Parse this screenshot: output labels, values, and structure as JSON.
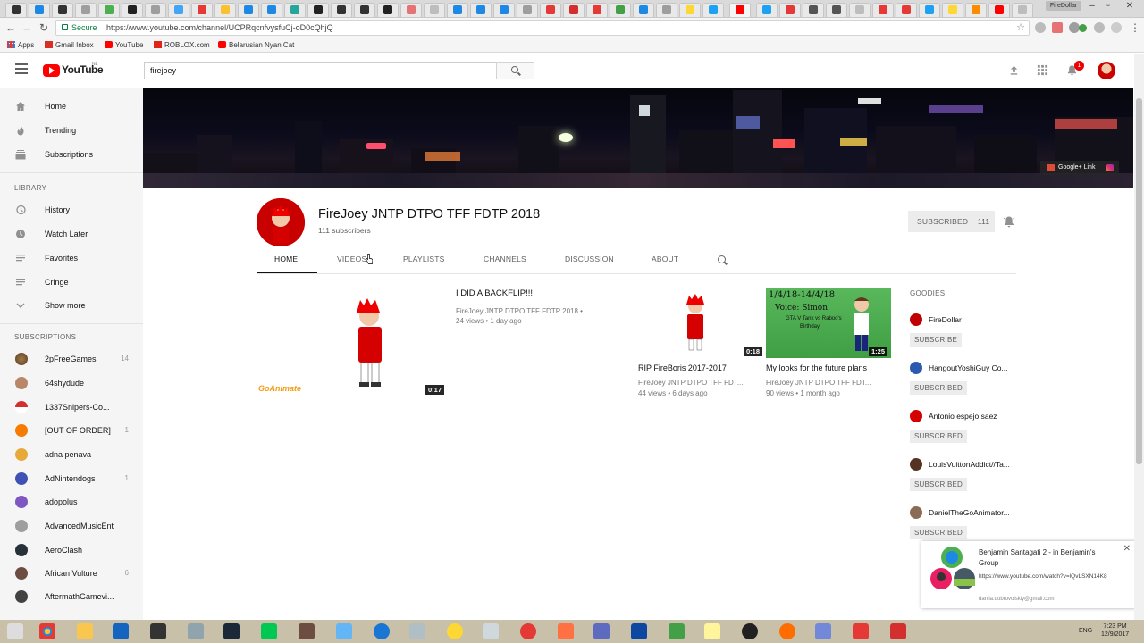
{
  "browser": {
    "profile_name": "FireDollar",
    "secure_label": "Secure",
    "url": "https://www.youtube.com/channel/UCPRqcnfvysfuCj-oD0cQhjQ",
    "bookmarks": [
      {
        "label": "Apps"
      },
      {
        "label": "Gmail Inbox"
      },
      {
        "label": "YouTube"
      },
      {
        "label": "ROBLOX.com"
      },
      {
        "label": "Belarusian Nyan Cat"
      }
    ]
  },
  "youtube": {
    "logo_text": "YouTube",
    "region": "NL",
    "search_value": "firejoey",
    "notification_count": "1"
  },
  "sidebar": {
    "main": [
      {
        "label": "Home",
        "icon": "home-icon"
      },
      {
        "label": "Trending",
        "icon": "flame-icon"
      },
      {
        "label": "Subscriptions",
        "icon": "subscriptions-icon"
      }
    ],
    "library_heading": "LIBRARY",
    "library": [
      {
        "label": "History",
        "icon": "history-icon"
      },
      {
        "label": "Watch Later",
        "icon": "clock-icon"
      },
      {
        "label": "Favorites",
        "icon": "playlist-icon"
      },
      {
        "label": "Cringe",
        "icon": "playlist-icon"
      },
      {
        "label": "Show more",
        "icon": "chevron-down-icon"
      }
    ],
    "subscriptions_heading": "SUBSCRIPTIONS",
    "subscriptions": [
      {
        "label": "2pFreeGames",
        "count": "14"
      },
      {
        "label": "64shydude",
        "count": ""
      },
      {
        "label": "1337Snipers-Co...",
        "count": ""
      },
      {
        "label": "[OUT OF ORDER]",
        "count": "1"
      },
      {
        "label": "adna penava",
        "count": ""
      },
      {
        "label": "AdNintendogs",
        "count": "1"
      },
      {
        "label": "adopolus",
        "count": ""
      },
      {
        "label": "AdvancedMusicEnt",
        "count": ""
      },
      {
        "label": "AeroClash",
        "count": ""
      },
      {
        "label": "African Vulture",
        "count": "6"
      },
      {
        "label": "AftermathGamevi...",
        "count": ""
      }
    ]
  },
  "banner": {
    "gplus_label": "Google+ Link"
  },
  "channel": {
    "title": "FireJoey JNTP DTPO TFF FDTP 2018",
    "subscribers": "111 subscribers",
    "subscribe_label": "SUBSCRIBED",
    "subscribe_count": "111",
    "tabs": [
      "HOME",
      "VIDEOS",
      "PLAYLISTS",
      "CHANNELS",
      "DISCUSSION",
      "ABOUT"
    ]
  },
  "featured": {
    "title": "I DID A BACKFLIP!!!",
    "channel": "FireJoey JNTP DTPO TFF FDTP 2018 •",
    "meta": "24 views • 1 day ago",
    "duration": "0:17",
    "watermark": "GoAnimate"
  },
  "videos": [
    {
      "title": "RIP FireBoris 2017-2017",
      "channel": "FireJoey JNTP DTPO TFF FDT...",
      "meta": "44 views • 6 days ago",
      "duration": "0:18"
    },
    {
      "title": "My looks for the future plans",
      "channel": "FireJoey JNTP DTPO TFF FDT...",
      "meta": "90 views • 1 month ago",
      "duration": "1:25",
      "thumb_text_1": "1/4/18-14/4/18",
      "thumb_text_2": "Voice: Simon",
      "thumb_text_3": "GTA V Tank vs Raboo's",
      "thumb_text_4": "Birthday"
    }
  ],
  "goodies": {
    "heading": "GOODIES",
    "items": [
      {
        "name": "FireDollar",
        "button": "SUBSCRIBE",
        "color": "#c00000"
      },
      {
        "name": "HangoutYoshiGuy Co...",
        "button": "SUBSCRIBED",
        "color": "#2a5bb0"
      },
      {
        "name": "Antonio espejo saez",
        "button": "SUBSCRIBED",
        "color": "#d40000"
      },
      {
        "name": "LouisVuittonAddict//Ta...",
        "button": "SUBSCRIBED",
        "color": "#553322"
      },
      {
        "name": "DanielTheGoAnimator...",
        "button": "SUBSCRIBED",
        "color": "#8a6b55"
      }
    ]
  },
  "toast": {
    "title": "Benjamin Santagati 2 - in Benjamin's Group",
    "link": "https://www.youtube.com/watch?v=lQvLSXN14K8",
    "account": "danila.dobrovolskiy@gmail.com"
  },
  "taskbar": {
    "lang": "ENG",
    "time": "7:23 PM",
    "date": "12/9/2017"
  }
}
